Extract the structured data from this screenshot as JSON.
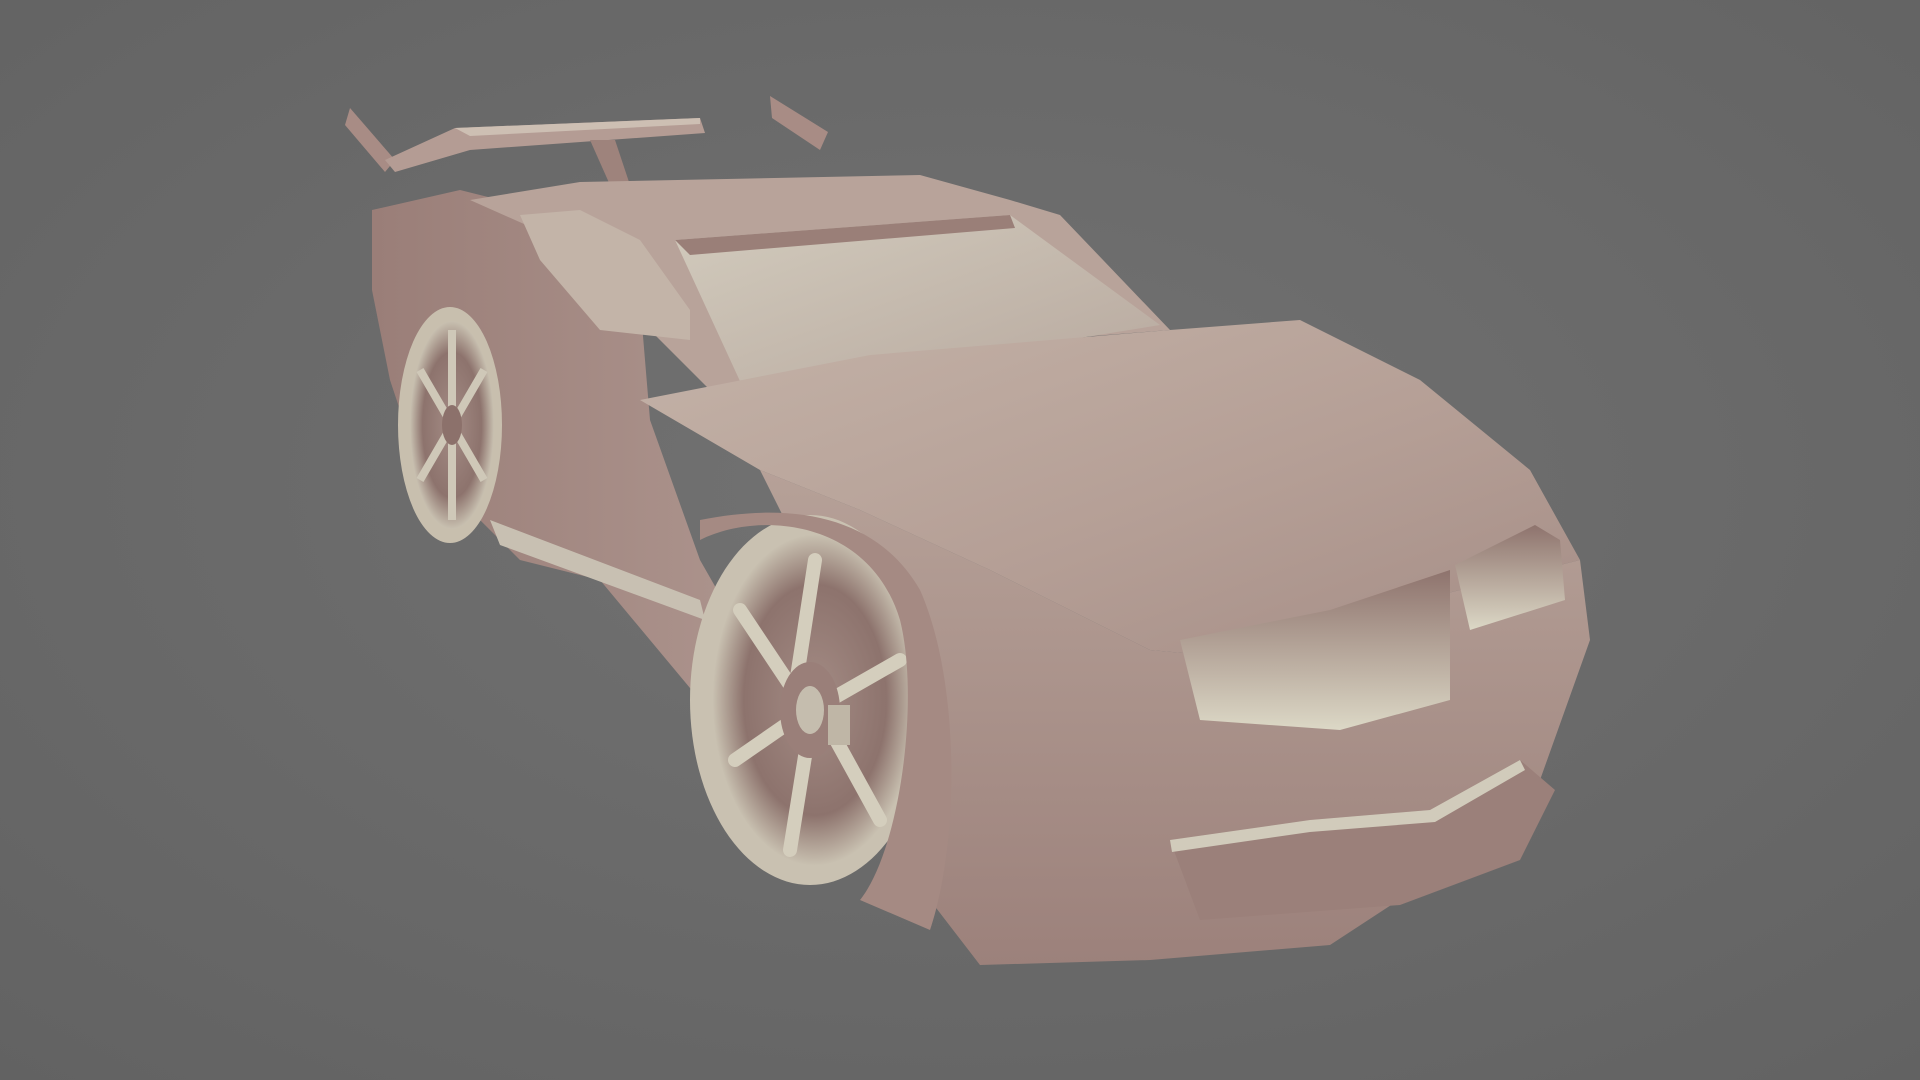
{
  "scene": {
    "subject": "car-model",
    "background_color": "#6b6b6b",
    "body_color": "#a88e87",
    "highlight_color": "#d9d4c2",
    "shadow_color": "#6e5650"
  }
}
